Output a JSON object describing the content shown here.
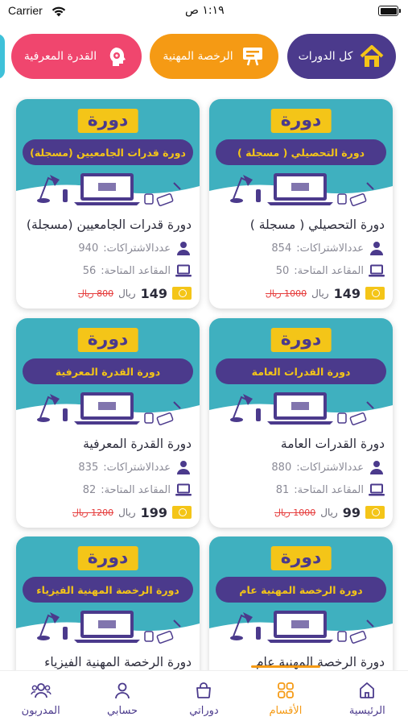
{
  "status_bar": {
    "carrier": "Carrier",
    "time": "١:١٩ ص"
  },
  "categories": [
    {
      "label": "كل الدورات",
      "icon": "home-icon",
      "color": "#4b3a8c"
    },
    {
      "label": "الرخصة المهنية",
      "icon": "certificate-board-icon",
      "color": "#f59a14"
    },
    {
      "label": "القدرة المعرفية",
      "icon": "brain-gear-icon",
      "color": "#f0466e"
    }
  ],
  "course_badge": "دورة",
  "labels": {
    "subscriptions": "عددالاشتراكات:",
    "seats": "المقاعد المتاحة:",
    "currency": "ريال"
  },
  "courses": [
    {
      "banner": "دورة التحصيلي ( مسجلة )",
      "title": "دورة التحصيلي ( مسجلة )",
      "subscriptions": "854",
      "seats": "50",
      "price": "149",
      "old_price": "1000 ريال"
    },
    {
      "banner": "دورة قدرات الجامعيين  (مسجلة)",
      "title": "دورة قدرات الجامعيين  (مسجلة)",
      "subscriptions": "940",
      "seats": "56",
      "price": "149",
      "old_price": "800 ريال"
    },
    {
      "banner": "دورة القدرات العامة",
      "title": "دورة القدرات العامة",
      "subscriptions": "880",
      "seats": "81",
      "price": "99",
      "old_price": "1000 ريال"
    },
    {
      "banner": "دورة القدرة المعرفية",
      "title": "دورة القدرة المعرفية",
      "subscriptions": "835",
      "seats": "82",
      "price": "199",
      "old_price": "1200 ريال"
    },
    {
      "banner": "دورة الرخصة المهنية عام",
      "title": "دورة الرخصة المهنية عام"
    },
    {
      "banner": "دورة الرخصة المهنية  الفيزياء",
      "title": "دورة الرخصة المهنية  الفيزياء"
    }
  ],
  "tabs": [
    {
      "label": "الرئيسية",
      "icon": "home-icon"
    },
    {
      "label": "الأقسام",
      "icon": "grid-icon",
      "active": true
    },
    {
      "label": "دوراتي",
      "icon": "bag-icon"
    },
    {
      "label": "حسابي",
      "icon": "user-icon"
    },
    {
      "label": "المدربون",
      "icon": "users-icon"
    }
  ],
  "colors": {
    "primary": "#4b3a8c",
    "accent": "#f59a14",
    "pink": "#f0466e",
    "teal": "#3fb0bf",
    "yellow": "#f4c518",
    "strike_red": "#e53b3b"
  }
}
